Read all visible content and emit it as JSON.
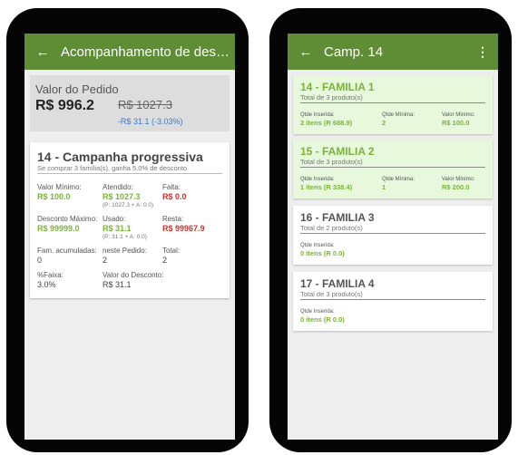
{
  "left": {
    "title": "Acompanhamento de descontos",
    "order": {
      "label": "Valor do Pedido",
      "price": "R$ 996.2",
      "old_price": "R$ 1027.3",
      "discount": "-R$ 31.1 (-3.03%)"
    },
    "campaign": {
      "title": "14 - Campanha progressiva",
      "subtitle": "Se comprar 3 família(s), ganha 5.0% de desconto",
      "rows": [
        [
          {
            "label": "Valor Mínimo:",
            "value": "R$ 100.0",
            "color": "#7bb33a"
          },
          {
            "label": "Atendido:",
            "value": "R$ 1027.3",
            "color": "#7bb33a",
            "note": "(P: 1027.3 + A: 0.0)"
          },
          {
            "label": "Falta:",
            "value": "R$ 0.0",
            "color": "#d0312d"
          }
        ],
        [
          {
            "label": "Desconto Máximo:",
            "value": "R$ 99999.0",
            "color": "#7bb33a"
          },
          {
            "label": "Usado:",
            "value": "R$ 31.1",
            "color": "#7bb33a",
            "note": "(P: 31.1 + A: 0.0)"
          },
          {
            "label": "Resta:",
            "value": "R$ 99967.9",
            "color": "#d0312d"
          }
        ],
        [
          {
            "label": "Fam. acumuladas:",
            "value": "0"
          },
          {
            "label": "neste Pedido:",
            "value": "2"
          },
          {
            "label": "Total:",
            "value": "2"
          }
        ],
        [
          {
            "label": "%Faixa:",
            "value": "3.0%"
          },
          {
            "label": "Valor do Desconto:",
            "value": "R$ 31.1"
          }
        ]
      ]
    }
  },
  "right": {
    "title": "Camp. 14",
    "menu_icon": "more-vert-icon",
    "families": [
      {
        "title": "14 - FAMILIA 1",
        "subtitle": "Total de 3 produto(s)",
        "active": true,
        "fields": [
          {
            "label": "Qtde Inserida:",
            "value": "2 itens (R 688.9)"
          },
          {
            "label": "Qtde Mínima:",
            "value": "2"
          },
          {
            "label": "Valor Mínimo:",
            "value": "R$ 100.0"
          }
        ]
      },
      {
        "title": "15 - FAMILIA 2",
        "subtitle": "Total de 3 produto(s)",
        "active": true,
        "fields": [
          {
            "label": "Qtde Inserida:",
            "value": "1 itens (R 338.4)"
          },
          {
            "label": "Qtde Mínima:",
            "value": "1"
          },
          {
            "label": "Valor Mínimo:",
            "value": "R$ 200.0"
          }
        ]
      },
      {
        "title": "16 - FAMILIA 3",
        "subtitle": "Total de 2 produto(s)",
        "active": false,
        "fields": [
          {
            "label": "Qtde Inserida:",
            "value": "0 itens (R 0.0)"
          }
        ]
      },
      {
        "title": "17 - FAMILIA 4",
        "subtitle": "Total de 3 produto(s)",
        "active": false,
        "fields": [
          {
            "label": "Qtde Inserida:",
            "value": "0 itens (R 0.0)"
          }
        ]
      }
    ]
  },
  "colors": {
    "appbar": "#5e8d36",
    "green": "#7bb33a",
    "red": "#d0312d",
    "blue": "#3b7bc9",
    "active_bg": "#e7f8dd"
  }
}
